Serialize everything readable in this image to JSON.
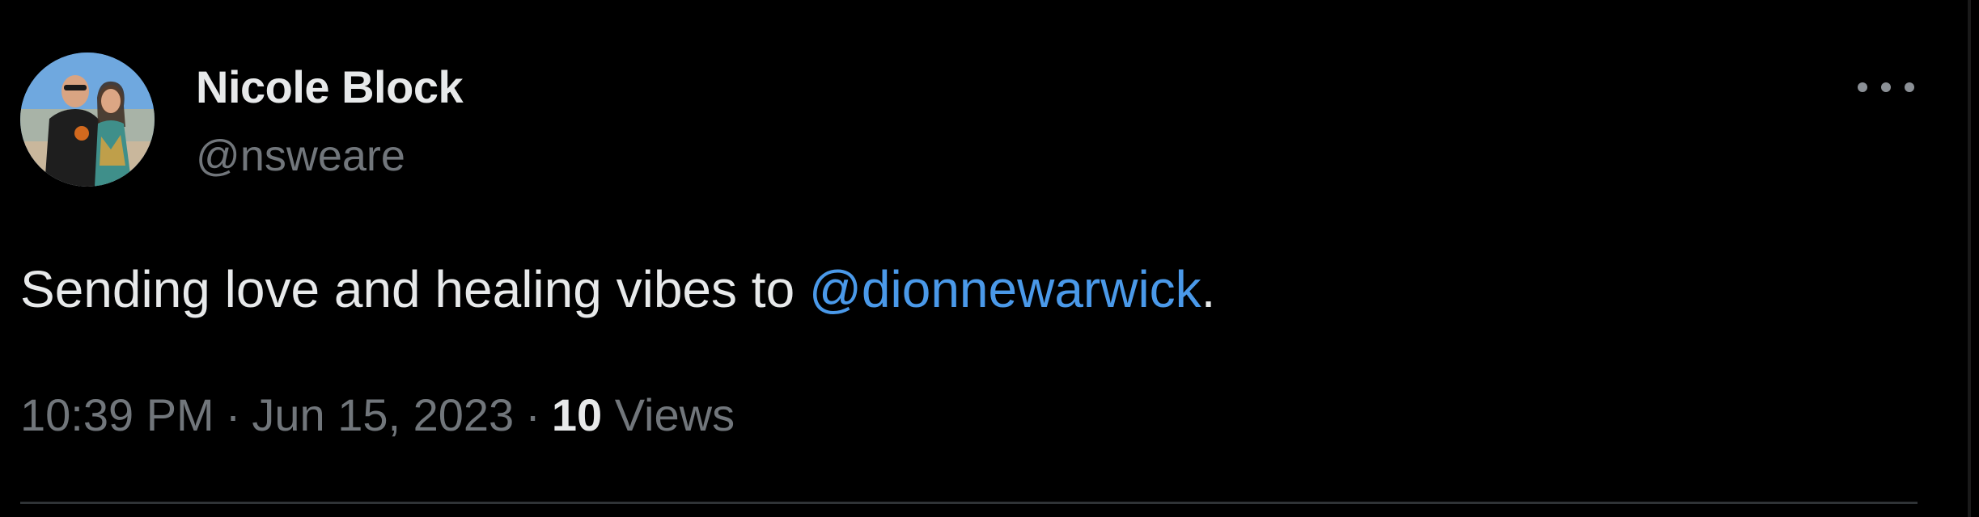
{
  "tweet": {
    "author": {
      "display_name": "Nicole Block",
      "handle": "@nsweare",
      "avatar": "profile-photo"
    },
    "text_before": "Sending love and healing vibes to ",
    "mention": "@dionnewarwick",
    "text_after": ".",
    "time": "10:39 PM",
    "separator": "·",
    "date": "Jun 15, 2023",
    "views_count": "10",
    "views_label": "Views",
    "more_icon": "more-horizontal-icon"
  },
  "colors": {
    "background": "#000000",
    "text_primary": "#e7e9ea",
    "text_secondary": "#71767b",
    "link": "#4a99e9",
    "divider": "#2f3336"
  }
}
